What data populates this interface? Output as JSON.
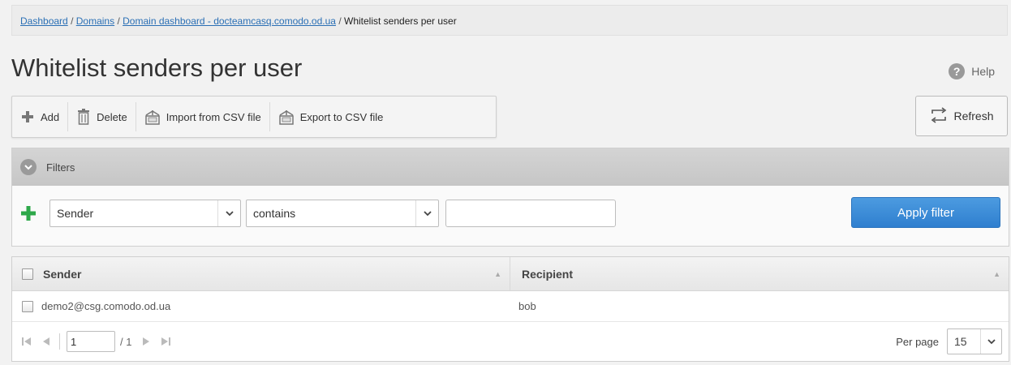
{
  "breadcrumb": {
    "items": [
      {
        "label": "Dashboard",
        "link": true
      },
      {
        "label": "Domains",
        "link": true
      },
      {
        "label": "Domain dashboard - docteamcasq.comodo.od.ua",
        "link": true
      },
      {
        "label": "Whitelist senders per user",
        "link": false
      }
    ],
    "separator": "/"
  },
  "page": {
    "title": "Whitelist senders per user",
    "help_label": "Help"
  },
  "toolbar": {
    "add_label": "Add",
    "delete_label": "Delete",
    "import_label": "Import from CSV file",
    "export_label": "Export to CSV file",
    "refresh_label": "Refresh"
  },
  "filters": {
    "header_label": "Filters",
    "field_value": "Sender",
    "operator_value": "contains",
    "text_value": "",
    "apply_label": "Apply filter"
  },
  "grid": {
    "columns": [
      "Sender",
      "Recipient"
    ],
    "rows": [
      {
        "sender": "demo2@csg.comodo.od.ua",
        "recipient": "bob"
      }
    ]
  },
  "pager": {
    "current_page": "1",
    "total_pages": "/ 1",
    "per_page_label": "Per page",
    "per_page_value": "15"
  },
  "colors": {
    "accent": "#2f7fcf",
    "link": "#2a6fb5",
    "add_green": "#2ea84a"
  }
}
